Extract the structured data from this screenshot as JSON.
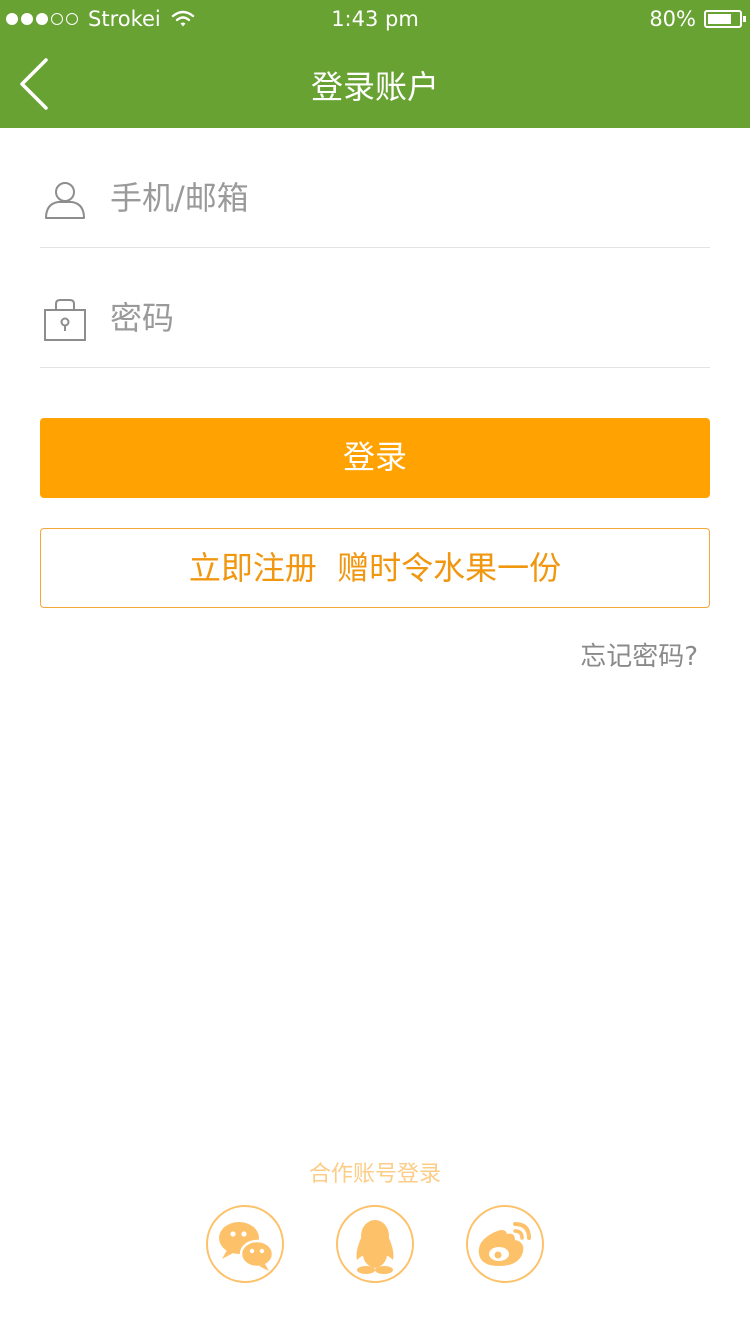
{
  "status_bar": {
    "carrier": "Strokei",
    "time": "1:43 pm",
    "battery_text": "80%",
    "battery_level": 0.8,
    "signal_dots_filled": 3,
    "signal_dots_total": 5
  },
  "nav": {
    "title": "登录账户",
    "back_icon": "chevron-left-icon"
  },
  "form": {
    "account_placeholder": "手机/邮箱",
    "account_value": "",
    "account_icon": "user-icon",
    "password_placeholder": "密码",
    "password_value": "",
    "password_icon": "lock-icon"
  },
  "buttons": {
    "login_label": "登录",
    "register_label": "立即注册  赠时令水果一份",
    "forgot_label": "忘记密码?"
  },
  "partner": {
    "label": "合作账号登录",
    "icons": [
      "wechat-icon",
      "qq-icon",
      "weibo-icon"
    ]
  },
  "colors": {
    "header_green": "#67a232",
    "login_orange": "#ffa202",
    "register_orange": "#f1960f",
    "social_orange": "#fdc16a"
  }
}
